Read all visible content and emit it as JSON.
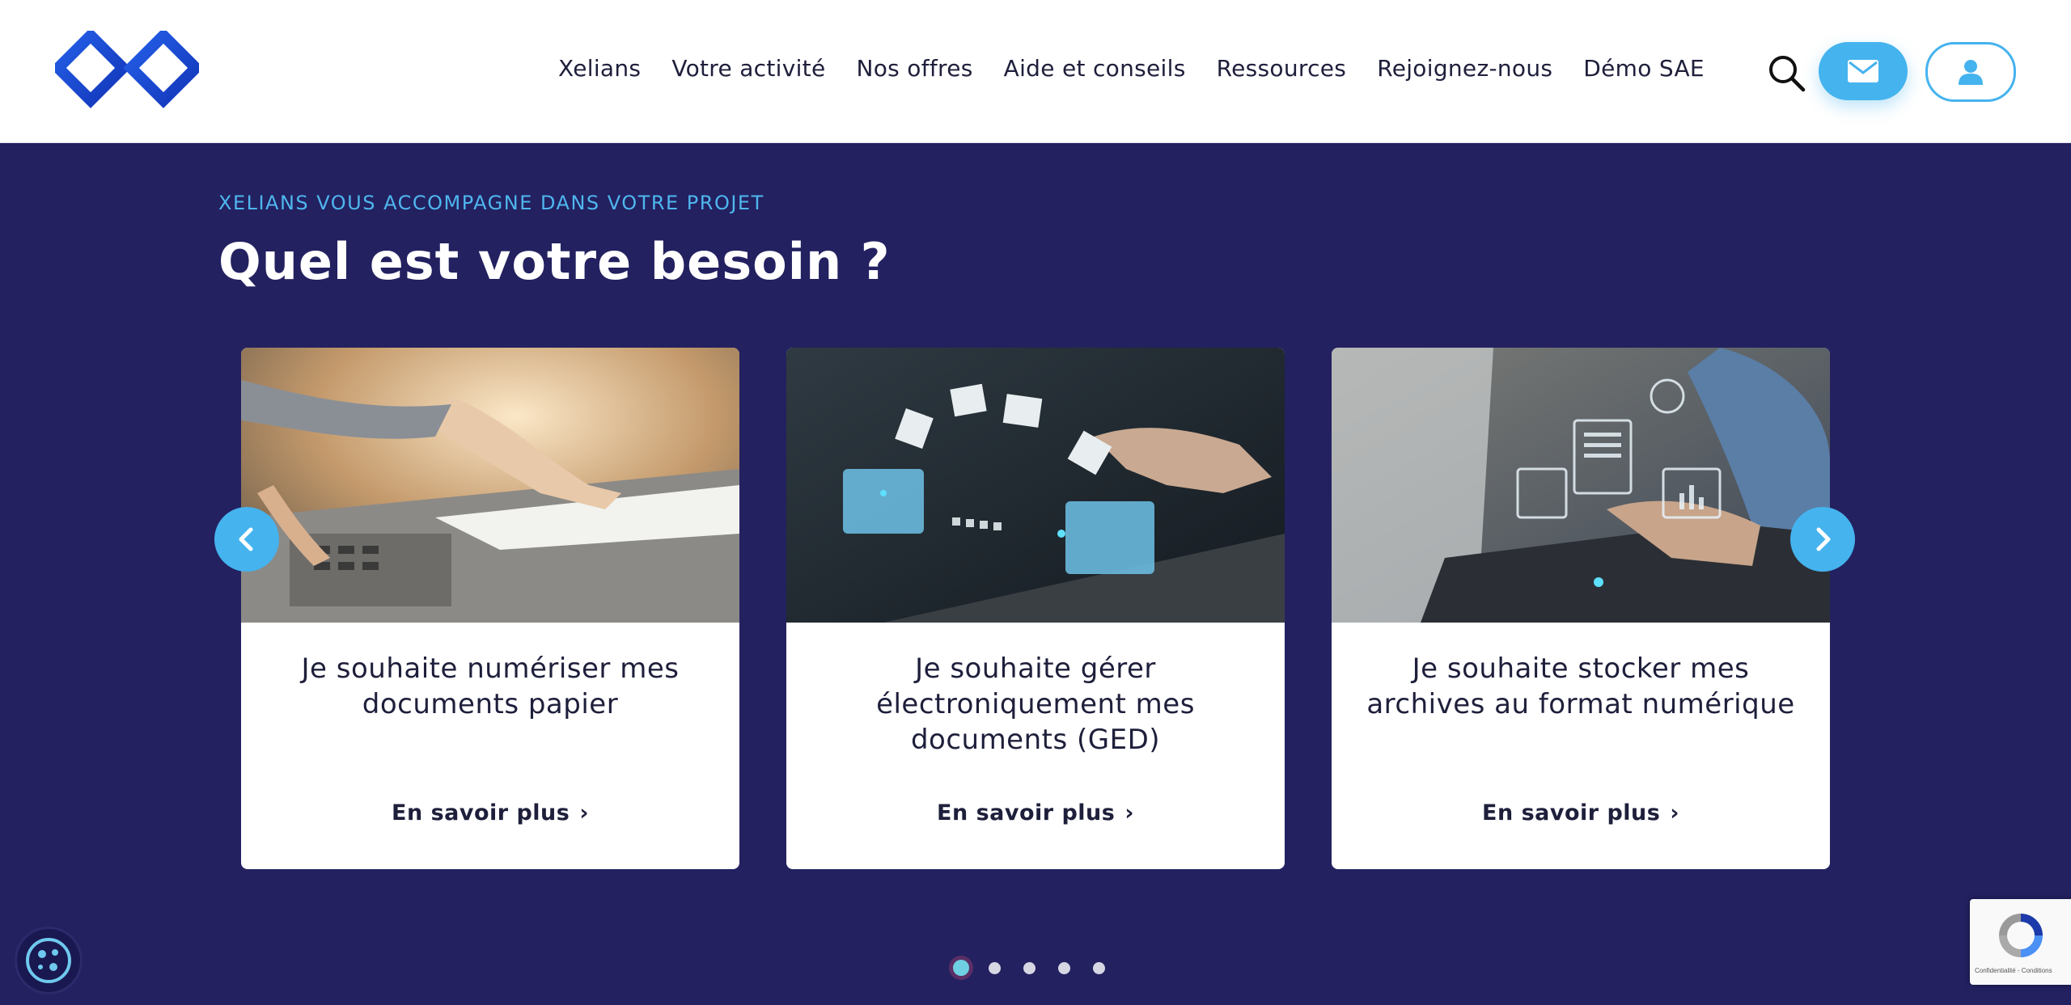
{
  "nav": {
    "items": [
      {
        "label": "Xelians"
      },
      {
        "label": "Votre activité"
      },
      {
        "label": "Nos offres"
      },
      {
        "label": "Aide et conseils"
      },
      {
        "label": "Ressources"
      },
      {
        "label": "Rejoignez-nous"
      },
      {
        "label": "Démo SAE"
      }
    ],
    "icons": {
      "search": "search-icon",
      "mail": "mail-icon",
      "user": "user-icon"
    }
  },
  "hero": {
    "eyebrow": "XELIANS VOUS ACCOMPAGNE DANS VOTRE PROJET",
    "title": "Quel est votre besoin ?",
    "cards": [
      {
        "text": "Je souhaite numériser mes documents papier",
        "link": "En savoir plus",
        "image": "scanner-photo"
      },
      {
        "text": "Je souhaite gérer électroniquement mes documents (GED)",
        "link": "En savoir plus",
        "image": "digital-files-photo"
      },
      {
        "text": "Je souhaite stocker mes archives au format numérique",
        "link": "En savoir plus",
        "image": "laptop-archive-photo"
      }
    ],
    "carousel": {
      "pages": 5,
      "active": 1
    }
  },
  "recaptcha": {
    "text": "Confidentialité - Conditions"
  },
  "colors": {
    "accent": "#45b3ee",
    "hero_bg": "#232160",
    "logo": "#1a4fd6"
  }
}
